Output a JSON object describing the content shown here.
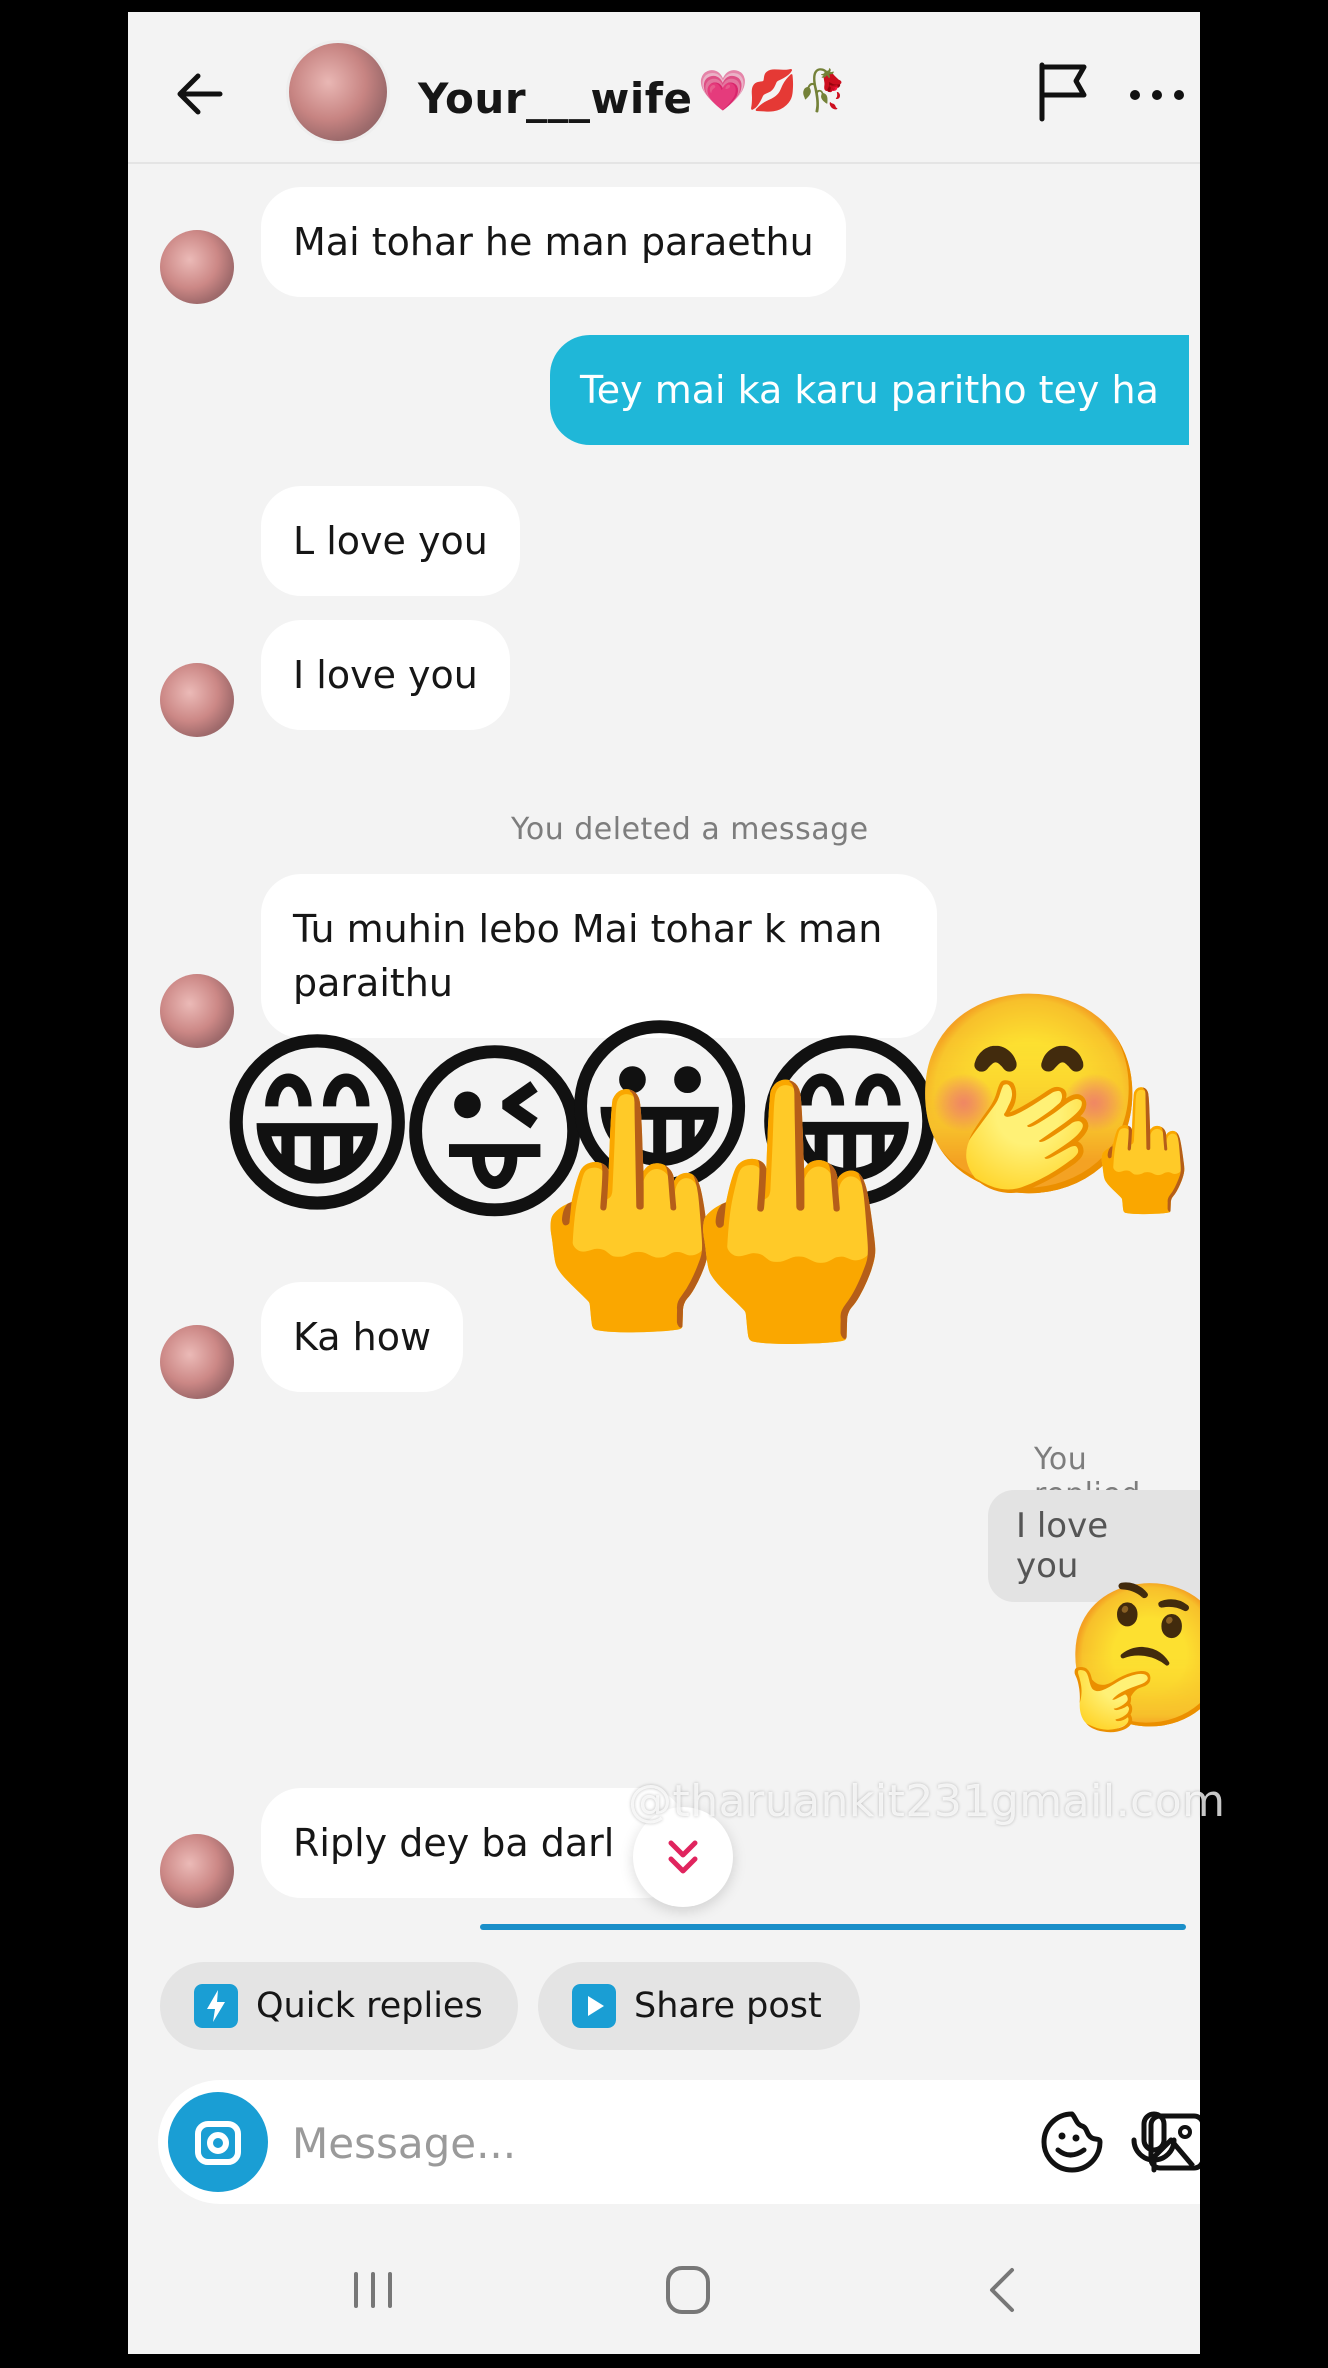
{
  "header": {
    "title": "Your___wife",
    "title_emoji": "💗💋🥀",
    "icons": [
      "back-arrow-icon",
      "flag-icon",
      "more-icon"
    ]
  },
  "messages": {
    "m1": "Mai tohar he man paraethu",
    "m2": "Tey mai ka karu paritho tey ha",
    "m3": "L love you",
    "m4": "I love you",
    "deleted_notice": "You deleted a message",
    "m5_line1": "Tu muhin lebo Mai tohar k man",
    "m5_line2": "paraithu",
    "m6": "Ka how",
    "replied_label": "You replied",
    "reply_quote": "I love you",
    "m7": "Riply dey ba darl"
  },
  "emoji_overlay": {
    "e1": "😁",
    "e2": "😜",
    "e3": "😀",
    "e4": "🖕",
    "e5": "🖕",
    "e6": "😁",
    "e7": "🤭",
    "e8": "🖕",
    "thinking": "🤔"
  },
  "watermark": "@tharuankit231gmail.com",
  "chips": {
    "quick_replies": "Quick replies",
    "share_post": "Share post"
  },
  "composer": {
    "placeholder": "Message..."
  },
  "colors": {
    "accent": "#1fb7d8",
    "camera": "#1a9ed4",
    "background": "#f3f3f3"
  }
}
